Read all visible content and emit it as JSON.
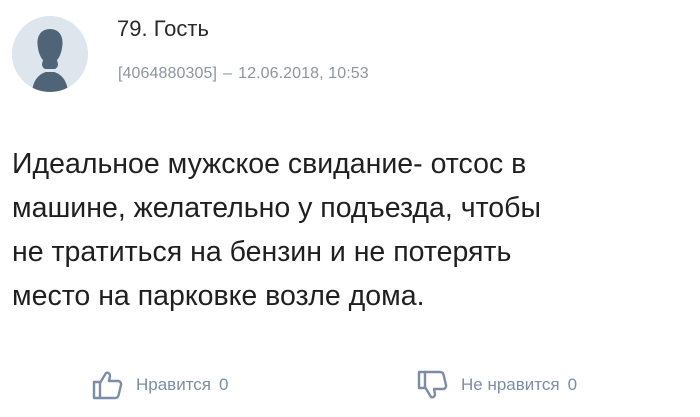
{
  "comment": {
    "number_author": "79. Гость",
    "user_id": "[4064880305]",
    "separator": "–",
    "datetime": "12.06.2018, 10:53",
    "text_lines": [
      "Идеальное мужское свидание- отсос в",
      "машине, желательно у подъезда, чтобы",
      "не тратиться на бензин и не потерять",
      "место на парковке возле дома."
    ],
    "actions": {
      "like_label": "Нравится",
      "like_count": "0",
      "dislike_label": "Не нравится",
      "dislike_count": "0"
    }
  },
  "icons": {
    "avatar": "user-silhouette-icon",
    "like": "thumbs-up-icon",
    "dislike": "thumbs-down-icon"
  },
  "colors": {
    "text": "#1f1f1f",
    "meta": "#8d959e",
    "action": "#7b8ea6",
    "avatar_bg": "#dfe5ed",
    "avatar_fg": "#4f6577"
  }
}
